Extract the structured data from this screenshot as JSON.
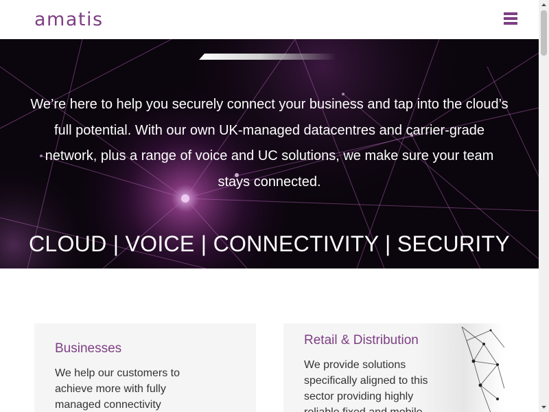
{
  "brand": {
    "logo_text": "amatis",
    "accent_color": "#7d3f83"
  },
  "header": {
    "menu_icon": "hamburger-menu-icon"
  },
  "hero": {
    "intro": "We’re here to help you securely connect your business and tap into the cloud’s full potential. With our own UK-managed datacentres and carrier-grade network, plus a range of voice and UC solutions, we make sure your team stays connected.",
    "tagline": "CLOUD | VOICE | CONNECTIVITY | SECURITY"
  },
  "cards": [
    {
      "title": "Businesses",
      "text": "We help our customers to achieve more with fully managed connectivity"
    },
    {
      "title": "Retail & Distribution",
      "text": "We provide solutions specifically aligned to this sector providing highly reliable fixed and mobile"
    }
  ],
  "scrollbar": {
    "up_icon": "scroll-up-arrow-icon",
    "down_icon": "scroll-down-arrow-icon"
  }
}
